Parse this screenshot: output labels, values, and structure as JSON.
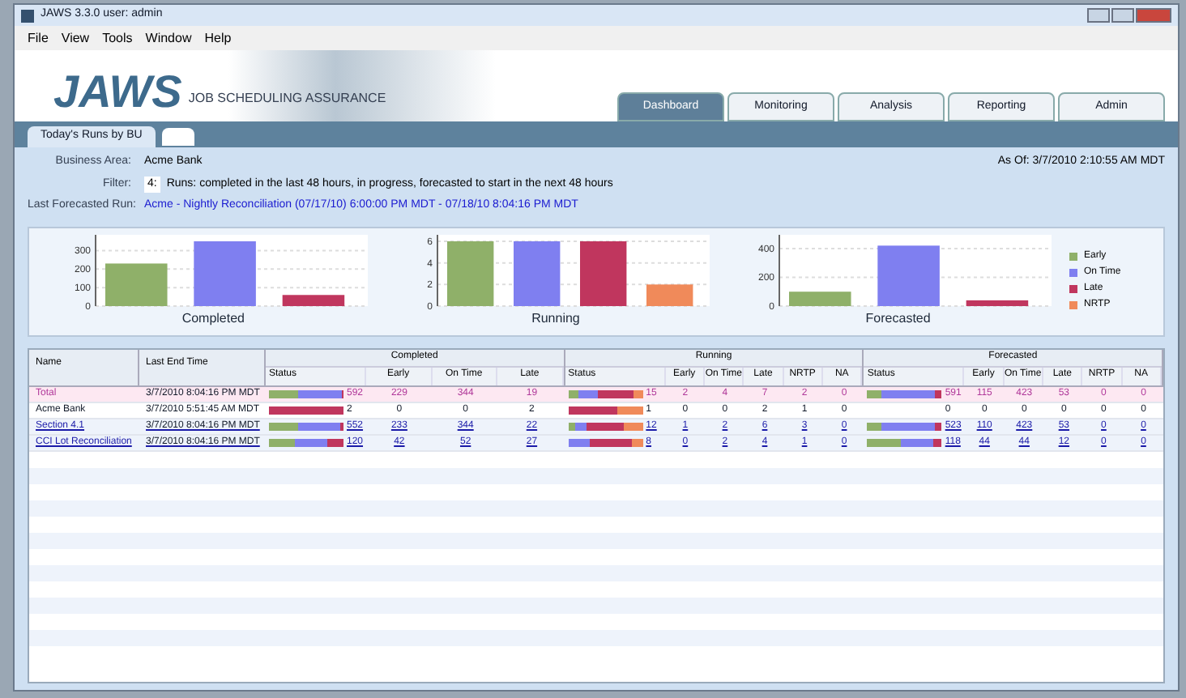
{
  "window": {
    "title": "JAWS 3.3.0 user: admin"
  },
  "menu": [
    "File",
    "View",
    "Tools",
    "Window",
    "Help"
  ],
  "banner": {
    "logo": "JAWS",
    "tagline": "JOB SCHEDULING ASSURANCE"
  },
  "tabs": [
    {
      "label": "Dashboard",
      "selected": true
    },
    {
      "label": "Monitoring",
      "selected": false
    },
    {
      "label": "Analysis",
      "selected": false
    },
    {
      "label": "Reporting",
      "selected": false
    },
    {
      "label": "Admin",
      "selected": false
    }
  ],
  "subtabs": [
    {
      "label": "Today's Runs by BU",
      "selected": true
    }
  ],
  "info": {
    "business_area_label": "Business Area:",
    "business_area": "Acme Bank",
    "as_of": "As Of: 3/7/2010 2:10:55 AM MDT",
    "filter_label": "Filter:",
    "filter_value": "4:",
    "filter_text": "Runs: completed in the last 48 hours, in progress, forecasted to start in the next 48 hours",
    "last_run_label": "Last Forecasted Run:",
    "last_run": "Acme - Nightly Reconciliation (07/17/10) 6:00:00 PM MDT - 07/18/10 8:04:16 PM MDT"
  },
  "legend": [
    {
      "label": "Early",
      "color": "#8fb069"
    },
    {
      "label": "On Time",
      "color": "#7f7ff0"
    },
    {
      "label": "Late",
      "color": "#c0365e"
    },
    {
      "label": "NRTP",
      "color": "#f08a5a"
    }
  ],
  "charts": [
    {
      "chart_data": {
        "type": "bar",
        "xlabel": "Completed",
        "grid": true,
        "categories": [
          null,
          null,
          null
        ],
        "values": [
          230,
          350,
          60
        ],
        "ylim": [
          0,
          350
        ],
        "yticks": [
          0,
          100,
          200,
          300
        ]
      }
    },
    {
      "chart_data": {
        "type": "bar",
        "xlabel": "Running",
        "grid": true,
        "categories": [
          null,
          null,
          null,
          null
        ],
        "values": [
          6,
          6,
          6,
          2
        ],
        "ylim": [
          0,
          6
        ],
        "yticks": [
          0,
          2,
          4,
          6
        ]
      }
    },
    {
      "chart_data": {
        "type": "bar",
        "xlabel": "Forecasted",
        "grid": true,
        "categories": [
          null,
          null,
          null
        ],
        "values": [
          100,
          420,
          40
        ],
        "ylim": [
          0,
          450
        ],
        "yticks": [
          0,
          200,
          400
        ]
      }
    }
  ],
  "table": {
    "columns": {
      "name": "Name",
      "last_end": "Last End Time",
      "groups": [
        {
          "label": "Completed",
          "columns": [
            "Status",
            "Early",
            "On Time",
            "Late"
          ]
        },
        {
          "label": "Running",
          "columns": [
            "Status",
            "Early",
            "On Time",
            "Late",
            "NRTP",
            "NA"
          ]
        },
        {
          "label": "Forecasted",
          "columns": [
            "Status",
            "Early",
            "On Time",
            "Late",
            "NRTP",
            "NA"
          ]
        }
      ]
    },
    "rows": [
      {
        "kind": "total",
        "name": "Total",
        "last_end": "3/7/2010 8:04:16 PM MDT",
        "groups": [
          [
            "592",
            "229",
            "344",
            "19"
          ],
          [
            "15",
            "2",
            "4",
            "7",
            "2",
            "0"
          ],
          [
            "591",
            "115",
            "423",
            "53",
            "0",
            "0"
          ]
        ]
      },
      {
        "kind": "plain",
        "name": "Acme Bank",
        "last_end": "3/7/2010 5:51:45 AM MDT",
        "groups": [
          [
            "2",
            "0",
            "0",
            "2"
          ],
          [
            "1",
            "0",
            "0",
            "2",
            "1",
            "0"
          ],
          [
            "0",
            "0",
            "0",
            "0",
            "0",
            "0"
          ]
        ]
      },
      {
        "kind": "link",
        "name": "Section 4.1",
        "last_end": "3/7/2010 8:04:16 PM MDT",
        "groups": [
          [
            "552",
            "233",
            "344",
            "22"
          ],
          [
            "12",
            "1",
            "2",
            "6",
            "3",
            "0"
          ],
          [
            "523",
            "110",
            "423",
            "53",
            "0",
            "0"
          ]
        ]
      },
      {
        "kind": "link",
        "name": "CCI Lot Reconciliation",
        "last_end": "3/7/2010 8:04:16 PM MDT",
        "groups": [
          [
            "120",
            "42",
            "52",
            "27"
          ],
          [
            "8",
            "0",
            "2",
            "4",
            "1",
            "0"
          ],
          [
            "118",
            "44",
            "44",
            "12",
            "0",
            "0"
          ]
        ]
      }
    ]
  }
}
